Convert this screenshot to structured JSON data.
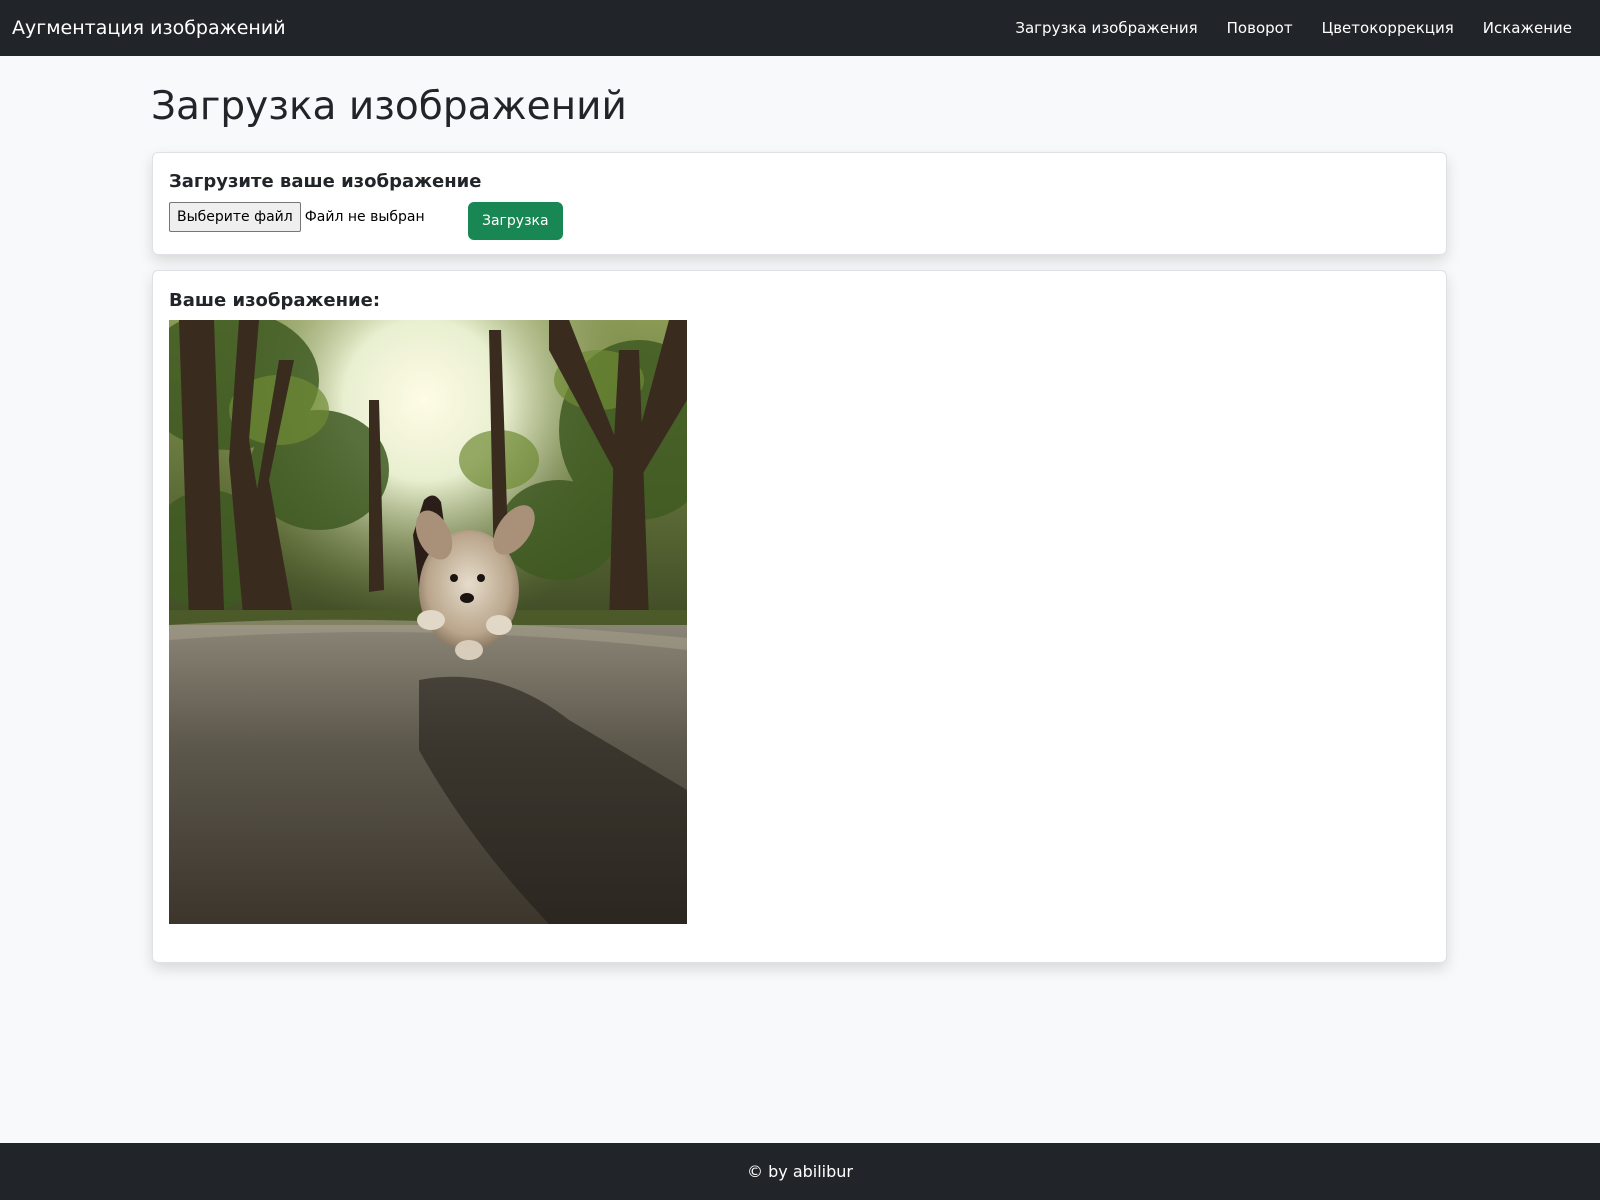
{
  "navbar": {
    "brand": "Аугментация изображений",
    "links": [
      "Загрузка изображения",
      "Поворот",
      "Цветокоррекция",
      "Искажение"
    ]
  },
  "page": {
    "title": "Загрузка изображений"
  },
  "upload_card": {
    "heading": "Загрузите ваше изображение",
    "file_button_label": "Выберите файл",
    "file_status": "Файл не выбран",
    "submit_label": "Загрузка"
  },
  "image_card": {
    "heading": "Ваше изображение:",
    "image_subject": "dog running on a tree-lined street"
  },
  "footer": {
    "text": "© by abilibur"
  },
  "colors": {
    "navbar_bg": "#212529",
    "page_bg": "#f8f9fa",
    "success_button": "#198754"
  }
}
